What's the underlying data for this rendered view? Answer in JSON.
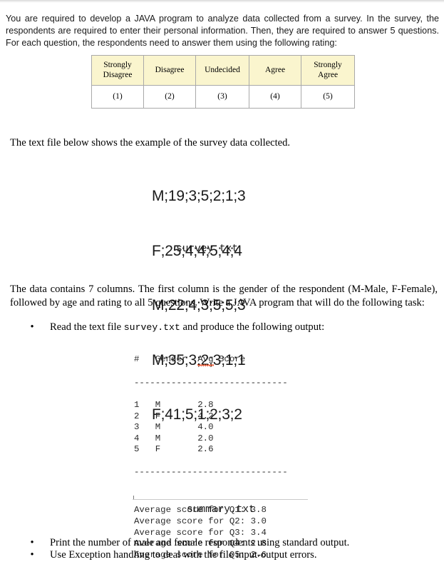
{
  "document": {
    "intro_paragraph": "You are required to develop a JAVA program to analyze data collected from a survey. In the survey, the respondents are required to enter their personal information. Then, they are required to answer 5 questions. For each question, the respondents need to answer them using the following rating:",
    "example_paragraph": "The text file below shows the example of the survey data collected.",
    "data_paragraph": "The data contains 7 columns. The first column is the gender of the respondent (M-Male, F-Female), followed by age and rating to all 5 questions. Write a JAVA program that will do the following task:"
  },
  "rating_table": {
    "headers": [
      "Strongly Disagree",
      "Disagree",
      "Undecided",
      "Agree",
      "Strongly Agree"
    ],
    "header_lines": [
      [
        "Strongly",
        "Disagree"
      ],
      [
        "Disagree"
      ],
      [
        "Undecided"
      ],
      [
        "Agree"
      ],
      [
        "Strongly",
        "Agree"
      ]
    ],
    "values": [
      "(1)",
      "(2)",
      "(3)",
      "(4)",
      "(5)"
    ],
    "header_bg": "#faf5ce",
    "border_color": "#a9a9a9"
  },
  "survey_file": {
    "caption": "survey.txt",
    "lines": [
      "M;19;3;5;2;1;3",
      "F;25;4;4;5;4;4",
      "M;22;4;3;5;5;3",
      "M;35;3;2;3;1;1",
      "F;41;5;1;2;3;2"
    ],
    "records": [
      {
        "gender": "M",
        "age": 19,
        "q1": 3,
        "q2": 5,
        "q3": 2,
        "q4": 1,
        "q5": 3
      },
      {
        "gender": "F",
        "age": 25,
        "q1": 4,
        "q2": 4,
        "q3": 5,
        "q4": 4,
        "q5": 4
      },
      {
        "gender": "M",
        "age": 22,
        "q1": 4,
        "q2": 3,
        "q3": 5,
        "q4": 5,
        "q5": 3
      },
      {
        "gender": "M",
        "age": 35,
        "q1": 3,
        "q2": 2,
        "q3": 3,
        "q4": 1,
        "q5": 1
      },
      {
        "gender": "F",
        "age": 41,
        "q1": 5,
        "q2": 1,
        "q3": 2,
        "q4": 3,
        "q5": 2
      }
    ]
  },
  "bullets": {
    "read": {
      "prefix": "Read the text file ",
      "code": "survey.txt",
      "suffix": " and produce the following output:"
    },
    "print": "Print the number of male and female respondents using standard output.",
    "exception": "Use Exception handling to deal with the file input-output errors."
  },
  "summary_file": {
    "caption": "summary.txt",
    "header_hash": "#",
    "header_gender": "Gender",
    "header_avg": "Avg",
    "header_score": "Score",
    "header_line": "#   Gender  Avg Score",
    "separator": "-----------------------------",
    "rows": [
      {
        "index": "1",
        "gender": "M",
        "avg": "2.8"
      },
      {
        "index": "2",
        "gender": "F",
        "avg": "4.2"
      },
      {
        "index": "3",
        "gender": "M",
        "avg": "4.0"
      },
      {
        "index": "4",
        "gender": "M",
        "avg": "2.0"
      },
      {
        "index": "5",
        "gender": "F",
        "avg": "2.6"
      }
    ],
    "rows_text": "1   M       2.8\n2   F       4.2\n3   M       4.0\n4   M       2.0\n5   F       2.6",
    "averages": [
      "Average score for Q1: 3.8",
      "Average score for Q2: 3.0",
      "Average score for Q3: 3.4",
      "Average score for Q4: 2.8",
      "Average score for Q5: 2.6"
    ],
    "averages_text": "Average score for Q1: 3.8\nAverage score for Q2: 3.0\nAverage score for Q3: 3.4\nAverage score for Q4: 2.8\nAverage score for Q5: 2.6",
    "question_averages": {
      "Q1": 3.8,
      "Q2": 3.0,
      "Q3": 3.4,
      "Q4": 2.8,
      "Q5": 2.6
    },
    "spellcheck_word": "Avg"
  }
}
